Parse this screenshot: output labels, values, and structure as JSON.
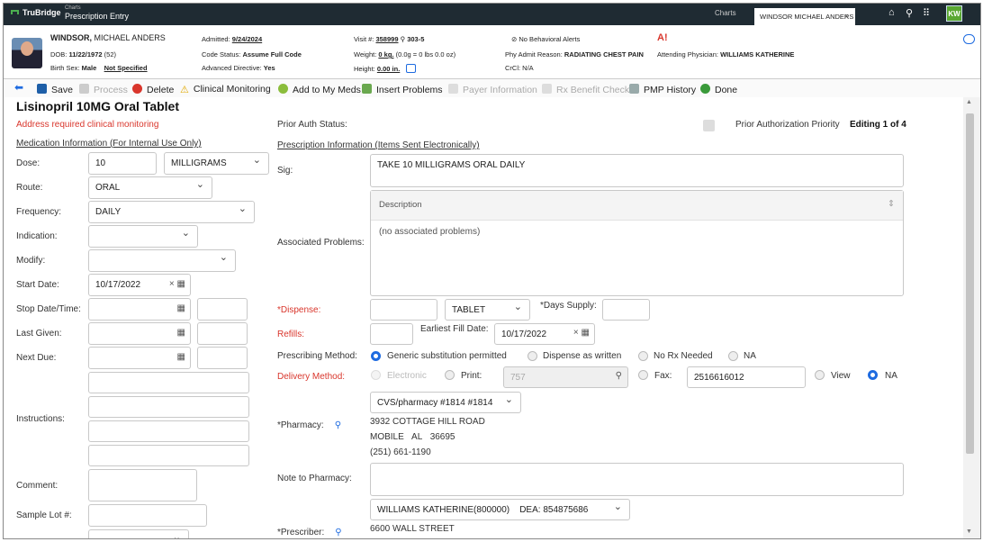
{
  "app": {
    "brand": "TruBridge",
    "crumb_top": "Charts",
    "crumb_title": "Prescription Entry",
    "tab_charts": "Charts",
    "tab_patient": "WINDSOR MICHAEL ANDERS",
    "user_initials": "KW"
  },
  "patient": {
    "last": "WINDSOR,",
    "first": "MICHAEL ANDERS",
    "dob_label": "DOB:",
    "dob": "11/22/1972",
    "age": "(52)",
    "sex_label": "Birth Sex:",
    "sex": "Male",
    "gender": "Not Specified",
    "admitted_label": "Admitted:",
    "admitted": "9/24/2024",
    "code_label": "Code Status:",
    "code": "Assume Full Code",
    "directive_label": "Advanced Directive:",
    "directive": "Yes",
    "visit_label": "Visit #:",
    "visit": "358999",
    "room": "303-5",
    "weight_label": "Weight:",
    "weight": "0 kg.",
    "weight_detail": "(0.0g = 0 lbs 0.0 oz)",
    "height_label": "Height:",
    "height": "0.00 in.",
    "alerts": "No Behavioral Alerts",
    "reason_label": "Phy Admit Reason:",
    "reason": "RADIATING CHEST PAIN",
    "crcl": "CrCl: N/A",
    "physician_label": "Attending Physician:",
    "physician": "WILLIAMS KATHERINE"
  },
  "toolbar": {
    "save": "Save",
    "process": "Process",
    "delete": "Delete",
    "clinical": "Clinical Monitoring",
    "addmeds": "Add to My Meds",
    "insert": "Insert Problems",
    "payer": "Payer Information",
    "benefit": "Rx Benefit Check",
    "pmp": "PMP History",
    "done": "Done"
  },
  "form": {
    "title": "Lisinopril 10MG Oral Tablet",
    "warning": "Address required clinical monitoring",
    "med_info": "Medication Information (For Internal Use Only)",
    "rx_info": "Prescription Information (Items Sent Electronically)",
    "prior_auth_label": "Prior Auth Status:",
    "prior_priority": "Prior Authorization Priority",
    "editing": "Editing 1 of 4",
    "dose_label": "Dose:",
    "dose": "10",
    "dose_unit": "MILLIGRAMS",
    "route_label": "Route:",
    "route": "ORAL",
    "freq_label": "Frequency:",
    "freq": "DAILY",
    "indication_label": "Indication:",
    "modify_label": "Modify:",
    "start_label": "Start Date:",
    "start": "10/17/2022",
    "stop_label": "Stop Date/Time:",
    "last_label": "Last Given:",
    "next_label": "Next Due:",
    "instr_label": "Instructions:",
    "comment_label": "Comment:",
    "lot_label": "Sample Lot #:",
    "sig_label": "Sig:",
    "sig": "TAKE 10 MILLIGRAMS ORAL DAILY",
    "assoc_label": "Associated Problems:",
    "desc_header": "Description",
    "no_problems": "(no associated problems)",
    "dispense_label": "*Dispense:",
    "dispense_unit": "TABLET",
    "days_label": "*Days Supply:",
    "refills_label": "Refills:",
    "earliest_label": "Earliest Fill Date:",
    "earliest": "10/17/2022",
    "method_label": "Prescribing Method:",
    "method_opts": [
      "Generic substitution permitted",
      "Dispense as written",
      "No Rx Needed",
      "NA"
    ],
    "delivery_label": "Delivery Method:",
    "electronic": "Electronic",
    "print": "Print:",
    "print_val": "757",
    "fax": "Fax:",
    "fax_val": "2516616012",
    "view": "View",
    "na": "NA",
    "pharmacy_label": "*Pharmacy:",
    "pharmacy": "CVS/pharmacy #1814 #1814",
    "ph_addr1": "3932 COTTAGE HILL ROAD",
    "ph_city": "MOBILE",
    "ph_state": "AL",
    "ph_zip": "36695",
    "ph_phone": "(251) 661-1190",
    "note_label": "Note to Pharmacy:",
    "prescriber_label": "*Prescriber:",
    "prescriber": "WILLIAMS KATHERINE(800000)    DEA: 854875686",
    "pr_addr": "6600 WALL STREET"
  }
}
